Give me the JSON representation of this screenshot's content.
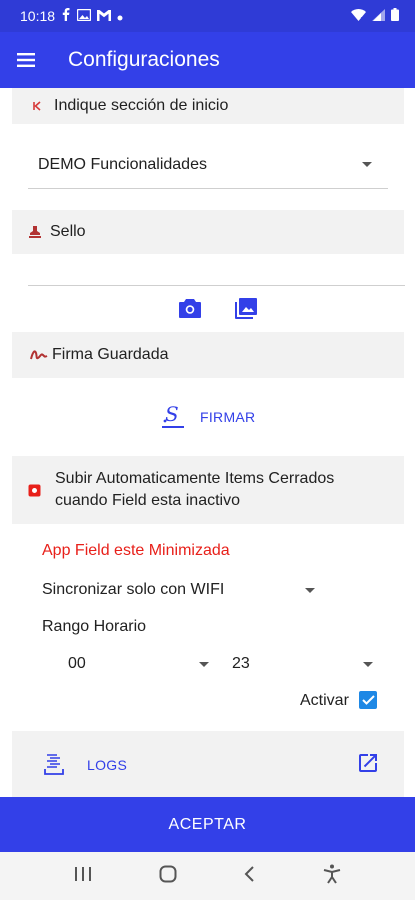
{
  "status_bar": {
    "time": "10:18",
    "icons": [
      "facebook-icon",
      "image-icon",
      "gmail-icon",
      "dot-icon"
    ],
    "right_icons": [
      "wifi-icon",
      "signal-icon",
      "battery-icon"
    ]
  },
  "app_bar": {
    "title": "Configuraciones",
    "menu_icon": "hamburger-menu-icon"
  },
  "start_section": {
    "label": "Indique sección de inicio",
    "selected": "DEMO Funcionalidades"
  },
  "stamp_section": {
    "label": "Sello",
    "actions": [
      "camera-icon",
      "gallery-icon"
    ]
  },
  "signature_section": {
    "label": "Firma Guardada",
    "sign_button": "FIRMAR"
  },
  "auto_upload_section": {
    "label": "Subir Automaticamente Items Cerrados cuando Field esta inactivo",
    "minimized_text": "App Field este Minimizada",
    "sync_option": "Sincronizar solo con WIFI",
    "range_label": "Rango Horario",
    "from_hour": "00",
    "to_hour": "23",
    "activate_label": "Activar",
    "activate_checked": true
  },
  "logs": {
    "label": "LOGS"
  },
  "accept_button": "ACEPTAR",
  "colors": {
    "primary": "#3340e8",
    "status_bar": "#2f3bd6",
    "red": "#e8201a",
    "section_bg": "#f2f2f2",
    "checkbox": "#1e88e5"
  }
}
